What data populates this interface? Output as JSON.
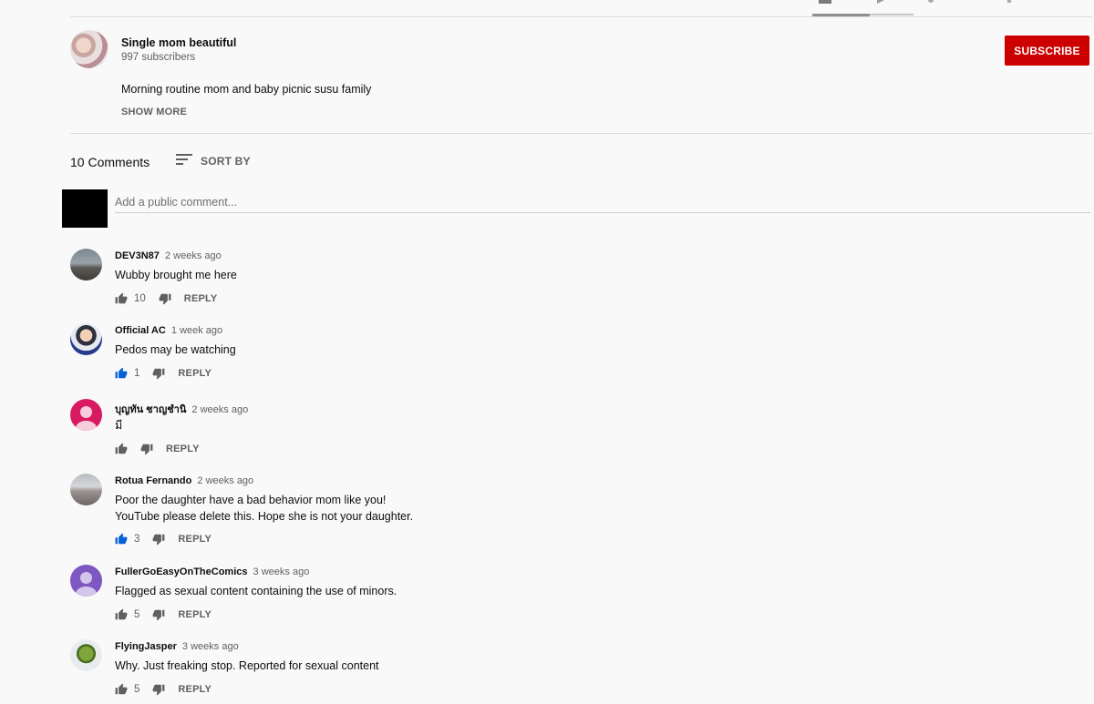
{
  "channel": {
    "name": "Single mom beautiful",
    "subscribers": "997 subscribers",
    "subscribe_label": "SUBSCRIBE"
  },
  "description": {
    "text": "Morning routine mom and baby picnic susu family",
    "show_more": "SHOW MORE"
  },
  "comments_header": {
    "count": "10 Comments",
    "sort_label": "SORT BY"
  },
  "comment_box": {
    "placeholder": "Add a public comment..."
  },
  "comments": [
    {
      "author": "DEV3N87",
      "time": "2 weeks ago",
      "text": "Wubby brought me here",
      "likes": "10",
      "liked": false,
      "reply": "REPLY"
    },
    {
      "author": "Official AC",
      "time": "1 week ago",
      "text": "Pedos may be watching",
      "likes": "1",
      "liked": true,
      "reply": "REPLY"
    },
    {
      "author": "บุญทัน ชาญชำนิ",
      "time": "2 weeks ago",
      "text": "มี",
      "likes": "",
      "liked": false,
      "reply": "REPLY"
    },
    {
      "author": "Rotua Fernando",
      "time": "2 weeks ago",
      "text": "Poor the daughter have a bad behavior mom like you!\nYouTube please delete this.  Hope she is not your daughter.",
      "likes": "3",
      "liked": true,
      "reply": "REPLY"
    },
    {
      "author": "FullerGoEasyOnTheComics",
      "time": "3 weeks ago",
      "text": "Flagged as sexual content containing the use of minors.",
      "likes": "5",
      "liked": false,
      "reply": "REPLY"
    },
    {
      "author": "FlyingJasper",
      "time": "3 weeks ago",
      "text": "Why. Just freaking stop. Reported for sexual content",
      "likes": "5",
      "liked": false,
      "reply": "REPLY"
    }
  ],
  "colors": {
    "subscribe_red": "#cc0000",
    "like_blue": "#065fd4",
    "icon_gray": "#606060"
  }
}
